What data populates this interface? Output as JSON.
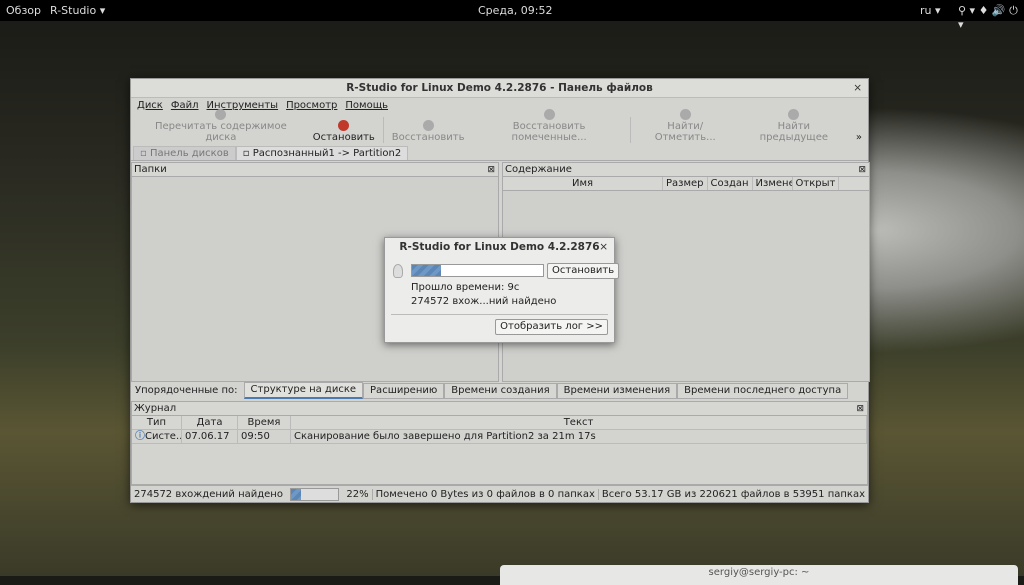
{
  "topbar": {
    "overview": "Обзор",
    "app": "R-Studio ▾",
    "clock": "Среда, 09:52",
    "lang": "ru ▾",
    "tray": "⚲ ▾   ♦ 🔊 ⏻ ▾"
  },
  "window": {
    "title": "R-Studio for Linux Demo 4.2.2876 - Панель файлов",
    "close": "×",
    "menu": [
      "Диск",
      "Файл",
      "Инструменты",
      "Просмотр",
      "Помощь"
    ],
    "toolbar": [
      "Перечитать содержимое диска",
      "Остановить",
      "Восстановить",
      "Восстановить помеченные...",
      "Найти/Отметить...",
      "Найти предыдущее"
    ],
    "toolbar_more": "»",
    "tabs": [
      "Панель дисков",
      "Распознанный1 -> Partition2"
    ],
    "folders_title": "Папки",
    "contents_title": "Содержание",
    "pane_close": "⊠",
    "contents_columns": [
      "Имя",
      "Размер",
      "Создан",
      "Изменен",
      "Открыт"
    ],
    "sort_label": "Упорядоченные по:",
    "sort_options": [
      "Структуре на диске",
      "Расширению",
      "Времени создания",
      "Времени изменения",
      "Времени последнего доступа"
    ],
    "journal_title": "Журнал",
    "journal_columns": [
      "Тип",
      "Дата",
      "Время",
      "Текст"
    ],
    "journal_rows": [
      {
        "type": "Систе...",
        "date": "07.06.17",
        "time": "09:50",
        "text": "Сканирование было завершено для Partition2 за 21m 17s"
      }
    ],
    "status": {
      "found": "274572 вхождений найдено",
      "progress_percent": 22,
      "percent_label": "22%",
      "marked": "Помечено 0 Bytes из 0 файлов в 0 папках",
      "total": "Всего 53.17 GB из 220621 файлов в 53951 папках"
    }
  },
  "dialog": {
    "title": "R-Studio for Linux Demo 4.2.2876",
    "close": "×",
    "progress_percent": 22,
    "stop": "Остановить",
    "elapsed": "Прошло времени: 9с",
    "found": "274572 вхож...ний найдено",
    "show_log": "Отобразить лог >>"
  },
  "terminal": {
    "title": "sergiy@sergiy-pc: ~"
  },
  "colors": {
    "accent": "#5b86b5",
    "stop": "#c0392b"
  }
}
